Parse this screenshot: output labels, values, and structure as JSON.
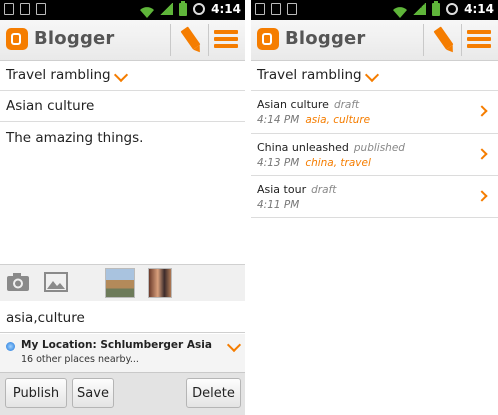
{
  "status_bar": {
    "time": "4:14"
  },
  "app": {
    "brand": "Blogger",
    "accent_color": "#f57d00"
  },
  "editor": {
    "blog_name": "Travel rambling",
    "post_title": "Asian culture",
    "post_body": "The amazing things.",
    "labels": "asia,culture",
    "location": {
      "title": "My Location: Schlumberger Asia",
      "subtitle": "16 other places nearby..."
    },
    "buttons": {
      "publish": "Publish",
      "save": "Save",
      "delete": "Delete"
    },
    "icons": [
      "camera-icon",
      "gallery-icon"
    ]
  },
  "post_list": {
    "blog_name": "Travel rambling",
    "posts": [
      {
        "title": "Asian culture",
        "status": "draft",
        "time": "4:14 PM",
        "labels": "asia, culture"
      },
      {
        "title": "China unleashed",
        "status": "published",
        "time": "4:13 PM",
        "labels": "china, travel"
      },
      {
        "title": "Asia tour",
        "status": "draft",
        "time": "4:11 PM",
        "labels": ""
      }
    ]
  }
}
